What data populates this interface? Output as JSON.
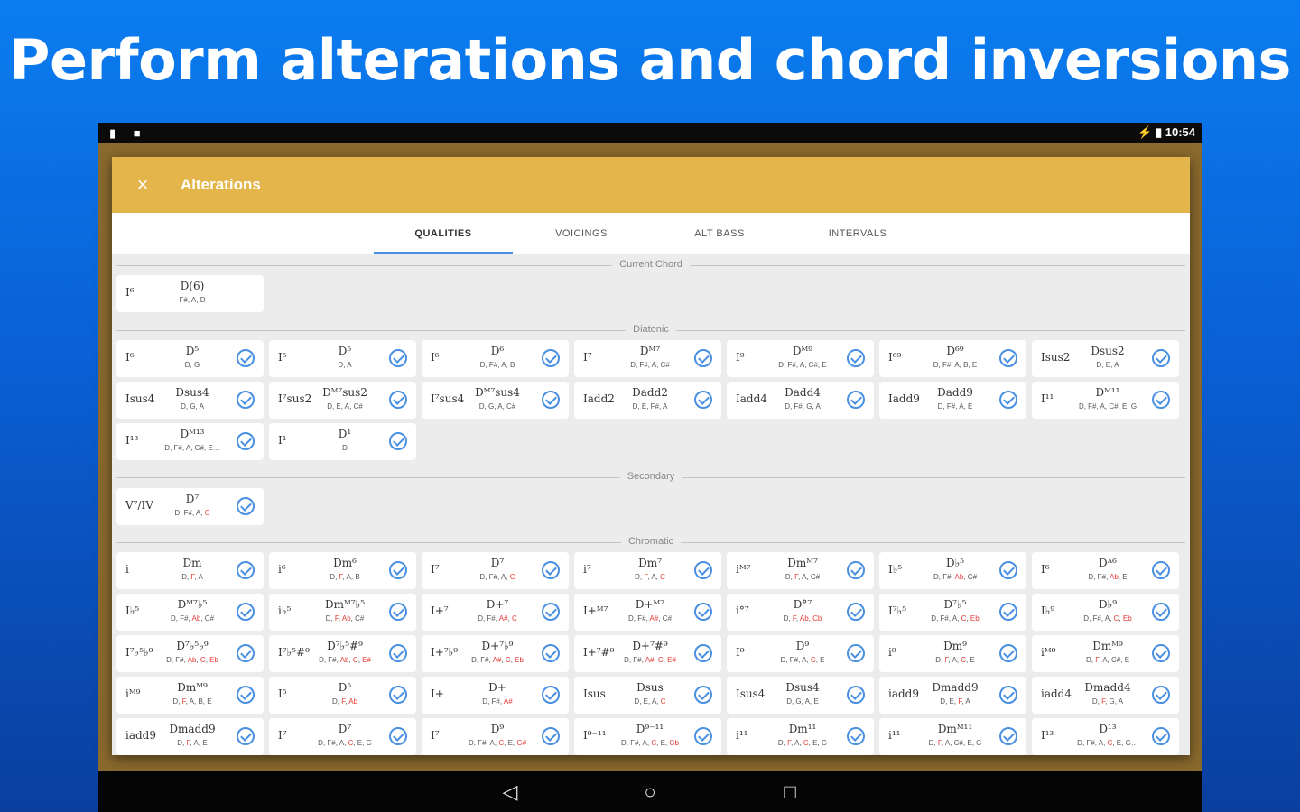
{
  "headline": "Perform alterations and chord inversions",
  "status": {
    "left_icons": "▮ ■",
    "right": "⚡ ▮ 10:54"
  },
  "dialog": {
    "close_icon": "×",
    "title": "Alterations"
  },
  "tabs": [
    {
      "label": "QUALITIES",
      "active": true
    },
    {
      "label": "VOICINGS",
      "active": false
    },
    {
      "label": "ALT BASS",
      "active": false
    },
    {
      "label": "INTERVALS",
      "active": false
    }
  ],
  "sections": {
    "current": "Current Chord",
    "diatonic": "Diatonic",
    "secondary": "Secondary",
    "chromatic": "Chromatic"
  },
  "current_chord": {
    "roman": "I⁶",
    "chord": "D(6)",
    "notes": "F#, A, D"
  },
  "diatonic": [
    {
      "roman": "I⁶",
      "chord": "D⁵",
      "notes": "D, G"
    },
    {
      "roman": "I⁵",
      "chord": "D⁵",
      "notes": "D, A"
    },
    {
      "roman": "I⁶",
      "chord": "D⁶",
      "notes": "D, F#, A, B"
    },
    {
      "roman": "I⁷",
      "chord": "Dᴹ⁷",
      "notes": "D, F#, A, C#"
    },
    {
      "roman": "I⁹",
      "chord": "Dᴹ⁹",
      "notes": "D, F#, A, C#, E"
    },
    {
      "roman": "I⁶⁹",
      "chord": "D⁶⁹",
      "notes": "D, F#, A, B, E"
    },
    {
      "roman": "Isus2",
      "chord": "Dsus2",
      "notes": "D, E, A"
    },
    {
      "roman": "Isus4",
      "chord": "Dsus4",
      "notes": "D, G, A"
    },
    {
      "roman": "I⁷sus2",
      "chord": "Dᴹ⁷sus2",
      "notes": "D, E, A, C#"
    },
    {
      "roman": "I⁷sus4",
      "chord": "Dᴹ⁷sus4",
      "notes": "D, G, A, C#"
    },
    {
      "roman": "Iadd2",
      "chord": "Dadd2",
      "notes": "D, E, F#, A"
    },
    {
      "roman": "Iadd4",
      "chord": "Dadd4",
      "notes": "D, F#, G, A"
    },
    {
      "roman": "Iadd9",
      "chord": "Dadd9",
      "notes": "D, F#, A, E"
    },
    {
      "roman": "I¹¹",
      "chord": "Dᴹ¹¹",
      "notes": "D, F#, A, C#, E, G"
    },
    {
      "roman": "I¹³",
      "chord": "Dᴹ¹³",
      "notes": "D, F#, A, C#, E…"
    },
    {
      "roman": "I¹",
      "chord": "D¹",
      "notes": "D"
    }
  ],
  "secondary": [
    {
      "roman": "V⁷/IV",
      "chord": "D⁷",
      "notes": "D, F#, A, C",
      "red": "C"
    }
  ],
  "chromatic": [
    {
      "roman": "i",
      "chord": "Dm",
      "notes": "D, F, A",
      "red": "F"
    },
    {
      "roman": "i⁶",
      "chord": "Dm⁶",
      "notes": "D, F, A, B",
      "red": "F"
    },
    {
      "roman": "I⁷",
      "chord": "D⁷",
      "notes": "D, F#, A, C",
      "red": "C"
    },
    {
      "roman": "i⁷",
      "chord": "Dm⁷",
      "notes": "D, F, A, C",
      "red": "F, C"
    },
    {
      "roman": "iᴹ⁷",
      "chord": "Dmᴹ⁷",
      "notes": "D, F, A, C#",
      "red": "F"
    },
    {
      "roman": "I♭⁵",
      "chord": "D♭⁵",
      "notes": "D, F#, Ab, C#",
      "red": "Ab"
    },
    {
      "roman": "I⁶",
      "chord": "Dᴬ⁶",
      "notes": "D, F#, Ab, E",
      "red": "Ab"
    },
    {
      "roman": "I♭⁵",
      "chord": "Dᴹ⁷♭⁵",
      "notes": "D, F#, Ab, C#",
      "red": "Ab"
    },
    {
      "roman": "i♭⁵",
      "chord": "Dmᴹ⁷♭⁵",
      "notes": "D, F, Ab, C#",
      "red": "F, Ab"
    },
    {
      "roman": "I+⁷",
      "chord": "D+⁷",
      "notes": "D, F#, A#, C",
      "red": "A#, C"
    },
    {
      "roman": "I+ᴹ⁷",
      "chord": "D+ᴹ⁷",
      "notes": "D, F#, A#, C#",
      "red": "A#"
    },
    {
      "roman": "i°⁷",
      "chord": "D°⁷",
      "notes": "D, F, Ab, Cb",
      "red": "F, Ab, Cb"
    },
    {
      "roman": "I⁷♭⁵",
      "chord": "D⁷♭⁵",
      "notes": "D, F#, A, C, Eb",
      "red": "C, Eb"
    },
    {
      "roman": "I♭⁹",
      "chord": "D♭⁹",
      "notes": "D, F#, A, C, Eb",
      "red": "C, Eb"
    },
    {
      "roman": "I⁷♭⁵♭⁹",
      "chord": "D⁷♭⁵♭⁹",
      "notes": "D, F#, Ab, C, Eb",
      "red": "Ab, C, Eb"
    },
    {
      "roman": "I⁷♭⁵#⁹",
      "chord": "D⁷♭⁵#⁹",
      "notes": "D, F#, Ab, C, E#",
      "red": "Ab, C, E#"
    },
    {
      "roman": "I+⁷♭⁹",
      "chord": "D+⁷♭⁹",
      "notes": "D, F#, A#, C, Eb",
      "red": "A#, C, Eb"
    },
    {
      "roman": "I+⁷#⁹",
      "chord": "D+⁷#⁹",
      "notes": "D, F#, A#, C, E#",
      "red": "A#, C, E#"
    },
    {
      "roman": "I⁹",
      "chord": "D⁹",
      "notes": "D, F#, A, C, E",
      "red": "C"
    },
    {
      "roman": "i⁹",
      "chord": "Dm⁹",
      "notes": "D, F, A, C, E",
      "red": "F, C"
    },
    {
      "roman": "iᴹ⁹",
      "chord": "Dmᴹ⁹",
      "notes": "D, F, A, C#, E",
      "red": "F"
    },
    {
      "roman": "iᴹ⁹",
      "chord": "Dmᴹ⁹",
      "notes": "D, F, A, B, E",
      "red": "F"
    },
    {
      "roman": "I⁵",
      "chord": "D⁵",
      "notes": "D, F, Ab",
      "red": "F, Ab"
    },
    {
      "roman": "I+",
      "chord": "D+",
      "notes": "D, F#, A#",
      "red": "A#"
    },
    {
      "roman": "Isus",
      "chord": "Dsus",
      "notes": "D, E, A, C",
      "red": "C"
    },
    {
      "roman": "Isus4",
      "chord": "Dsus4",
      "notes": "D, G, A, E",
      "red": ""
    },
    {
      "roman": "iadd9",
      "chord": "Dmadd9",
      "notes": "D, E, F, A",
      "red": "F"
    },
    {
      "roman": "iadd4",
      "chord": "Dmadd4",
      "notes": "D, F, G, A",
      "red": "F"
    },
    {
      "roman": "iadd9",
      "chord": "Dmadd9",
      "notes": "D, F, A, E",
      "red": "F"
    },
    {
      "roman": "I⁷",
      "chord": "D⁷",
      "notes": "D, F#, A, C, E, G",
      "red": "C"
    },
    {
      "roman": "I⁷",
      "chord": "D⁹",
      "notes": "D, F#, A, C, E, G#",
      "red": "C, G#"
    },
    {
      "roman": "I⁹⁻¹¹",
      "chord": "D⁹⁻¹¹",
      "notes": "D, F#, A, C, E, Gb",
      "red": "C, Gb"
    },
    {
      "roman": "i¹¹",
      "chord": "Dm¹¹",
      "notes": "D, F, A, C, E, G",
      "red": "F, C"
    },
    {
      "roman": "i¹¹",
      "chord": "Dmᴹ¹¹",
      "notes": "D, F, A, C#, E, G",
      "red": "F"
    },
    {
      "roman": "I¹³",
      "chord": "D¹³",
      "notes": "D, F#, A, C, E, G…",
      "red": "C"
    }
  ]
}
